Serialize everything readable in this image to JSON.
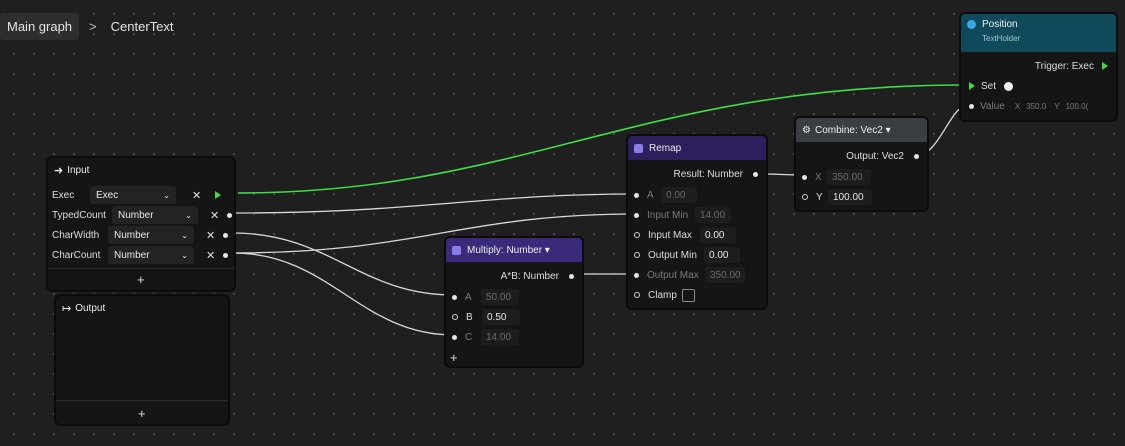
{
  "breadcrumb": {
    "main": "Main graph",
    "separator": ">",
    "current": "CenterText"
  },
  "colors": {
    "accent_exec": "#3fdc46",
    "multiply_header": "#3b2a7a",
    "remap_header": "#2d1f5c",
    "position_header": "#0e4a5a",
    "combine_header": "#3a3e42"
  },
  "input_node": {
    "title": "Input",
    "icon": "enter-arrow-icon",
    "rows": [
      {
        "label": "Exec",
        "type": "Exec"
      },
      {
        "label": "TypedCount",
        "type": "Number"
      },
      {
        "label": "CharWidth",
        "type": "Number"
      },
      {
        "label": "CharCount",
        "type": "Number"
      }
    ],
    "add": "+",
    "remove": "✕",
    "dropdown": "⌄"
  },
  "output_node": {
    "title": "Output",
    "icon": "exit-arrow-icon",
    "add": "+"
  },
  "multiply_node": {
    "title": "Multiply: Number ▾",
    "output": "A*B: Number",
    "inputs": [
      {
        "label": "A",
        "value": "50.00"
      },
      {
        "label": "B",
        "value": "0.50"
      },
      {
        "label": "C",
        "value": "14.00"
      }
    ],
    "add": "+"
  },
  "remap_node": {
    "title": "Remap",
    "output": "Result: Number",
    "inputs": [
      {
        "label": "A",
        "value": "0.00"
      },
      {
        "label": "Input Min",
        "value": "14.00"
      },
      {
        "label": "Input Max",
        "value": "0.00"
      },
      {
        "label": "Output Min",
        "value": "0.00"
      },
      {
        "label": "Output Max",
        "value": "350.00"
      },
      {
        "label": "Clamp"
      }
    ]
  },
  "combine_node": {
    "title": "Combine: Vec2 ▾",
    "output": "Output: Vec2",
    "inputs": [
      {
        "label": "X",
        "value": "350.00"
      },
      {
        "label": "Y",
        "value": "100.00"
      }
    ]
  },
  "position_node": {
    "title": "Position",
    "subtitle": "TextHolder",
    "trigger": "Trigger: Exec",
    "set": "Set",
    "value_label": "Value",
    "x_label": "X",
    "x_value": "350.0",
    "y_label": "Y",
    "y_value": "100.0("
  }
}
